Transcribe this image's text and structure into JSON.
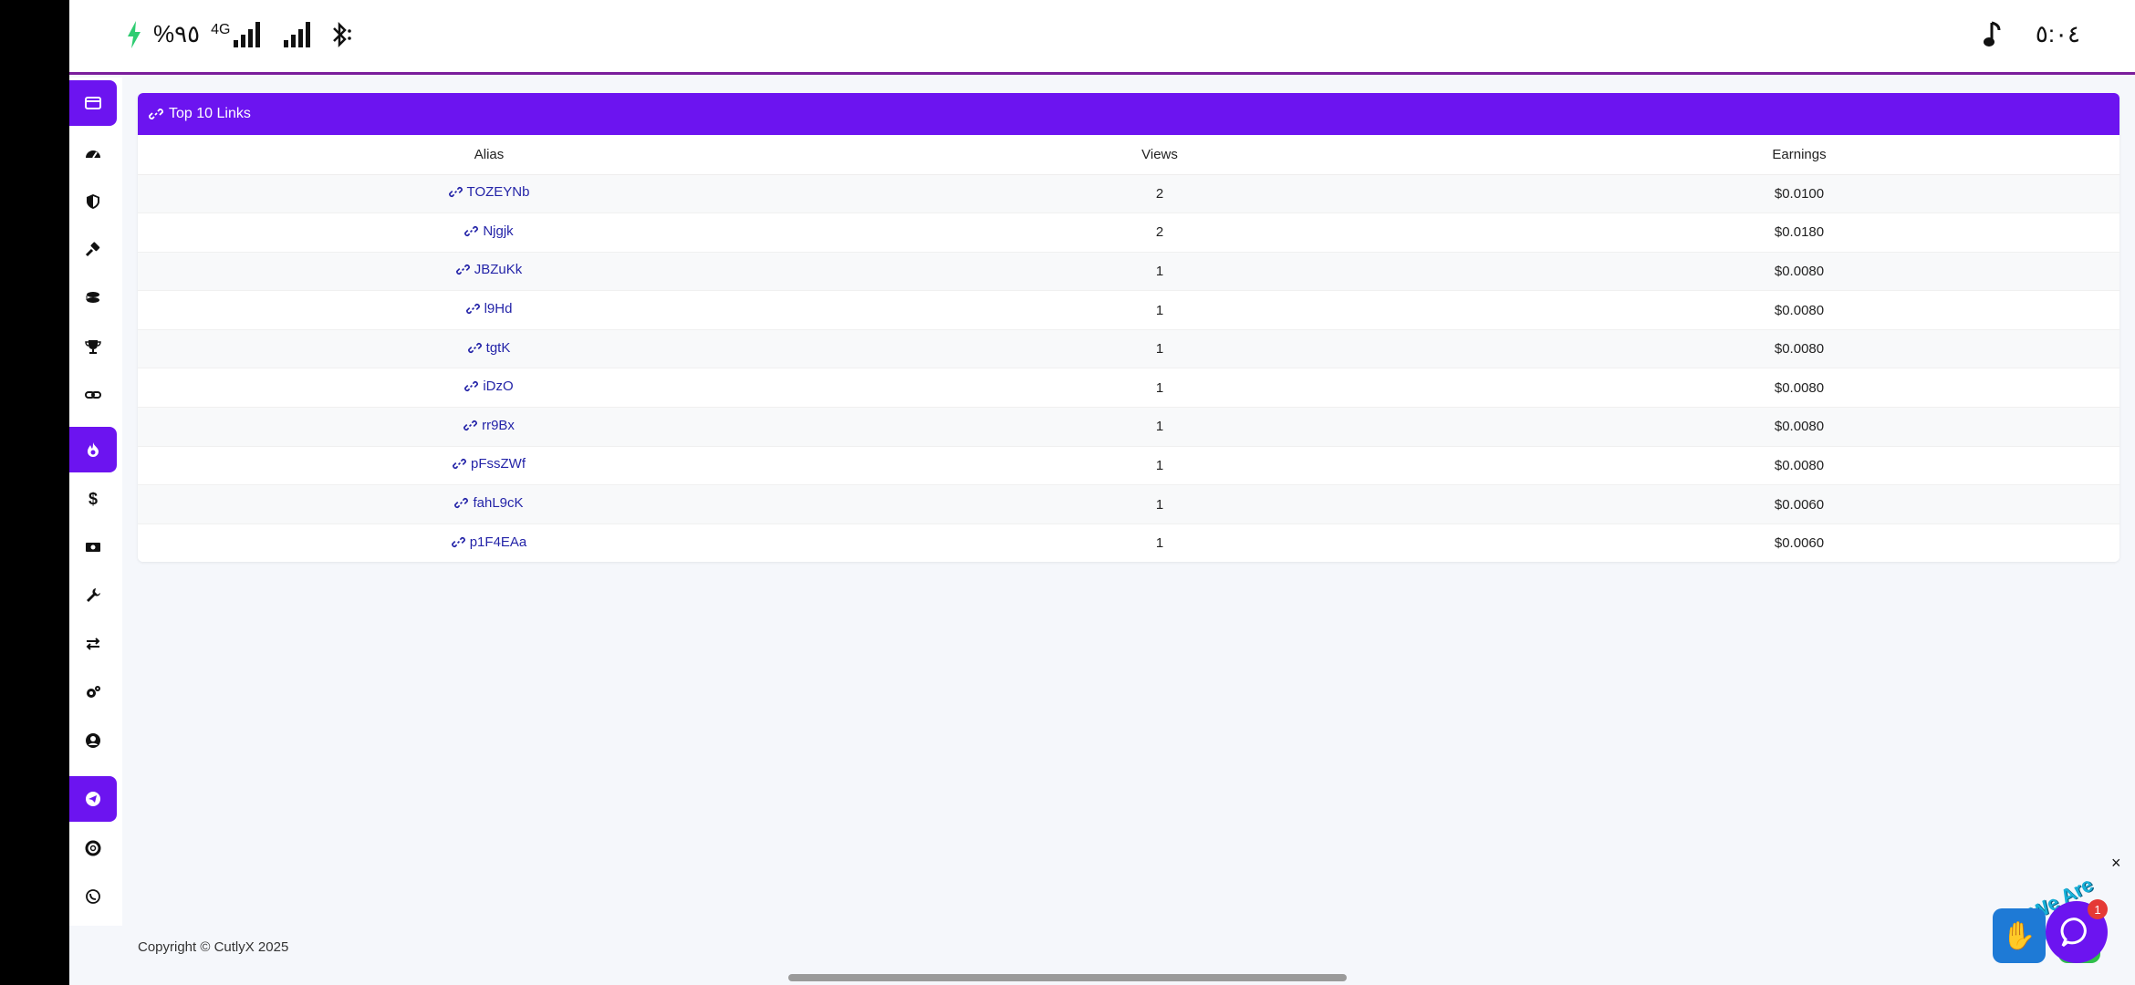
{
  "statusbar": {
    "battery": "%٩٥",
    "network": "4G",
    "time": "٥:٠٤"
  },
  "sidebar": {
    "items": [
      {
        "icon": "card-icon",
        "active": true
      },
      {
        "icon": "dashboard-icon",
        "active": false
      },
      {
        "icon": "shield-icon",
        "active": false
      },
      {
        "icon": "hammer-icon",
        "active": false
      },
      {
        "icon": "coins-icon",
        "active": false
      },
      {
        "icon": "trophy-icon",
        "active": false
      },
      {
        "icon": "link-icon",
        "active": false
      },
      {
        "icon": "fire-icon",
        "active": true
      },
      {
        "icon": "dollar-icon",
        "active": false
      },
      {
        "icon": "money-icon",
        "active": false
      },
      {
        "icon": "wrench-icon",
        "active": false
      },
      {
        "icon": "exchange-icon",
        "active": false
      },
      {
        "icon": "gears-icon",
        "active": false
      },
      {
        "icon": "user-circle-icon",
        "active": false
      },
      {
        "icon": "telegram-icon",
        "active": true
      },
      {
        "icon": "lifering-icon",
        "active": false
      },
      {
        "icon": "whatsapp-icon",
        "active": false
      }
    ]
  },
  "card": {
    "title": "Top 10 Links",
    "columns": [
      "Alias",
      "Views",
      "Earnings"
    ],
    "rows": [
      {
        "alias": "TOZEYNb",
        "views": "2",
        "earnings": "$0.0100"
      },
      {
        "alias": "Njgjk",
        "views": "2",
        "earnings": "$0.0180"
      },
      {
        "alias": "JBZuKk",
        "views": "1",
        "earnings": "$0.0080"
      },
      {
        "alias": "l9Hd",
        "views": "1",
        "earnings": "$0.0080"
      },
      {
        "alias": "tgtK",
        "views": "1",
        "earnings": "$0.0080"
      },
      {
        "alias": "iDzO",
        "views": "1",
        "earnings": "$0.0080"
      },
      {
        "alias": "rr9Bx",
        "views": "1",
        "earnings": "$0.0080"
      },
      {
        "alias": "pFssZWf",
        "views": "1",
        "earnings": "$0.0080"
      },
      {
        "alias": "fahL9cK",
        "views": "1",
        "earnings": "$0.0060"
      },
      {
        "alias": "p1F4EAa",
        "views": "1",
        "earnings": "$0.0060"
      }
    ]
  },
  "footer": {
    "copyright": "Copyright © CutlyX 2025"
  },
  "chat": {
    "label": "We Are Here!",
    "badge_count": "1",
    "close": "×"
  },
  "colors": {
    "accent": "#6c14f0",
    "link": "#2424a8",
    "status_border": "#7a1e9c"
  }
}
